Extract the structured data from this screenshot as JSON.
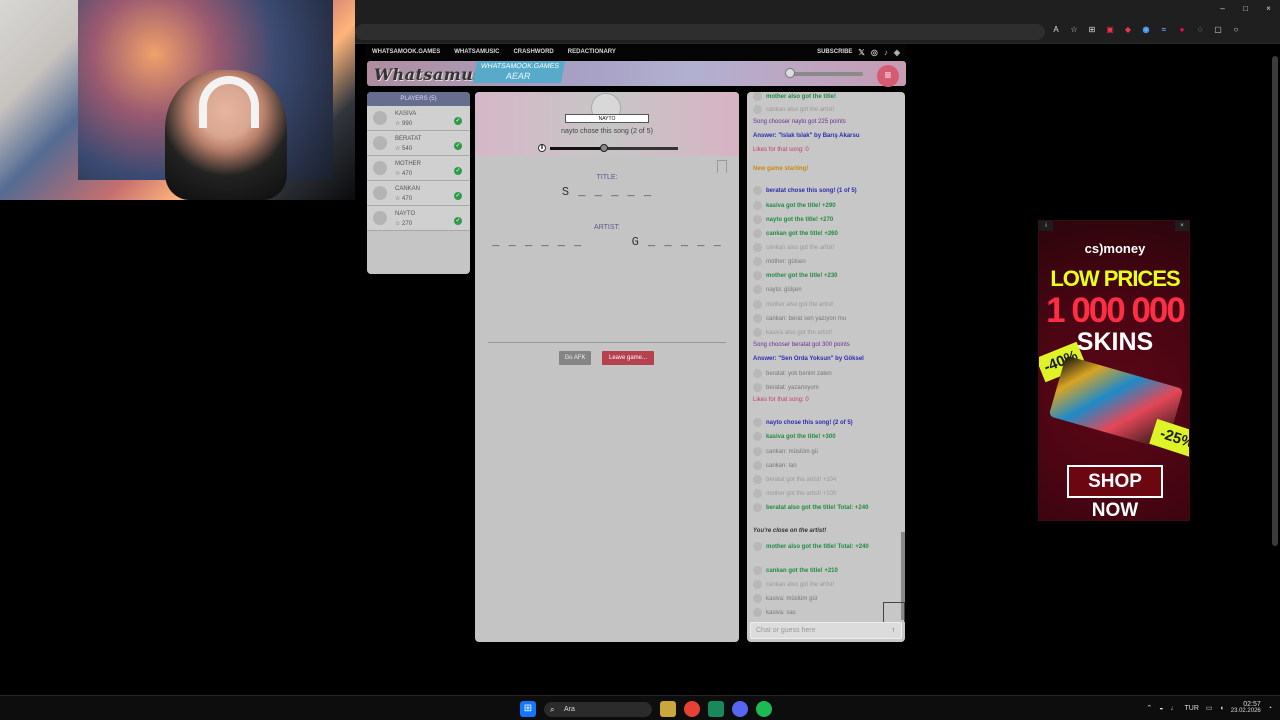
{
  "window": {
    "minimize": "–",
    "maximize": "□",
    "close": "×"
  },
  "toolbar": {
    "translate_icon": "A",
    "star_icon": "☆",
    "extensions": [
      "⊞",
      "▣",
      "◆",
      "◉",
      "≈",
      "●",
      "◌",
      "▢",
      "○"
    ]
  },
  "site": {
    "nav": {
      "items": [
        "WHATSAMOOK.GAMES",
        "WHATSAMUSIC",
        "CRASHWORD",
        "REDACTIONARY"
      ],
      "subscribe": "SUBSCRIBE",
      "social_icons": [
        "twitter",
        "instagram",
        "tiktok",
        "discord"
      ]
    },
    "logo": "Whatsamusic",
    "banner": {
      "line1": "WHATSAMOOK.GAMES",
      "line2": "AEAR"
    },
    "menu_icon": "≡"
  },
  "players": {
    "title": "PLAYERS (5)",
    "items": [
      {
        "name": "KASIVA",
        "score": "☆ 990"
      },
      {
        "name": "BERATAT",
        "score": "☆ 540"
      },
      {
        "name": "MOTHER",
        "score": "☆ 470"
      },
      {
        "name": "CANKAN",
        "score": "☆ 470"
      },
      {
        "name": "NAYTO",
        "score": "☆ 270"
      }
    ]
  },
  "game": {
    "chooser_name": "NAYTO",
    "chooser_text": "nayto chose this song (2 of 5)",
    "progress": 0.42,
    "title_label": "TITLE:",
    "title_value": "S _ _ _ _ _",
    "artist_label": "ARTIST:",
    "artist_value": "_ _ _ _ _ _      G _ _ _ _ _",
    "afk_button": "Go AFK",
    "leave_button": "Leave game..."
  },
  "chat": {
    "messages": [
      {
        "text": "mother also got the title!",
        "cls": "green",
        "dot": true
      },
      {
        "text": "cankan also got the artist!",
        "cls": "faint",
        "dot": true
      },
      {
        "text": "Song chooser nayto got 225 points",
        "cls": "purple",
        "dot": false
      },
      {
        "text": "Answer: \"Islak Islak\" by Barış Akarsu",
        "cls": "blue",
        "dot": false
      },
      {
        "text": "Likes for that song: 0",
        "cls": "pink",
        "dot": false
      },
      {
        "text": "New game starting!",
        "cls": "orange",
        "dot": false
      },
      {
        "text": "beratat chose this song! (1 of 5)",
        "cls": "blue",
        "dot": true
      },
      {
        "text": "kasiva got the title! +290",
        "cls": "green",
        "dot": true
      },
      {
        "text": "nayto got the title! +270",
        "cls": "green",
        "dot": true
      },
      {
        "text": "cankan got the title! +260",
        "cls": "green",
        "dot": true
      },
      {
        "text": "cankan also got the artist!",
        "cls": "faint",
        "dot": true
      },
      {
        "text": "mother: gülsen",
        "cls": "gray",
        "dot": true
      },
      {
        "text": "mother got the title! +230",
        "cls": "green",
        "dot": true
      },
      {
        "text": "nayto: gülşen",
        "cls": "gray",
        "dot": true
      },
      {
        "text": "mother also got the artist!",
        "cls": "faint",
        "dot": true
      },
      {
        "text": "cankan: berat sen yazıyon mu",
        "cls": "gray",
        "dot": true
      },
      {
        "text": "kasiva also got the artist!",
        "cls": "faint",
        "dot": true
      },
      {
        "text": "Song chooser beratat got 300 points",
        "cls": "purple",
        "dot": false
      },
      {
        "text": "Answer: \"Sen Orda Yoksun\" by Göksel",
        "cls": "blue",
        "dot": false
      },
      {
        "text": "beratat: yok benim zaten",
        "cls": "gray",
        "dot": true
      },
      {
        "text": "beratat: yazamıyom",
        "cls": "gray",
        "dot": true
      },
      {
        "text": "Likes for that song: 0",
        "cls": "pink",
        "dot": false
      },
      {
        "text": "nayto chose this song! (2 of 5)",
        "cls": "blue",
        "dot": true
      },
      {
        "text": "kasiva got the title! +300",
        "cls": "green",
        "dot": true
      },
      {
        "text": "cankan: müslüm gü",
        "cls": "gray",
        "dot": true
      },
      {
        "text": "cankan: lan",
        "cls": "gray",
        "dot": true
      },
      {
        "text": "beratat got the artist! +104",
        "cls": "faint",
        "dot": true
      },
      {
        "text": "mother got the artist! +100",
        "cls": "faint",
        "dot": true
      },
      {
        "text": "beratat also got the title! Total: +240",
        "cls": "green",
        "dot": true
      },
      {
        "text": "You're close on the artist!",
        "cls": "darkbold",
        "dot": false
      },
      {
        "text": "mother also got the title! Total: +240",
        "cls": "green",
        "dot": true
      },
      {
        "text": "cankan got the title! +210",
        "cls": "green",
        "dot": true
      },
      {
        "text": "cankan also got the artist!",
        "cls": "faint",
        "dot": true
      },
      {
        "text": "kasiva: müslüm gür",
        "cls": "gray",
        "dot": true
      },
      {
        "text": "kasiva: sas",
        "cls": "gray",
        "dot": true
      }
    ],
    "input_placeholder": "Chat or guess here",
    "send_icon": "↑"
  },
  "ad": {
    "info": "i",
    "close": "×",
    "brand": "cs)money",
    "headline": "LOW PRICES",
    "amount": "1 000 000",
    "product": "SKINS",
    "discount_left": "-40%",
    "discount_right": "-25%",
    "button": "SHOP NOW"
  },
  "taskbar": {
    "start_icon": "⊞",
    "search_placeholder": "Ara",
    "search_icon": "⌕",
    "apps": [
      "folder",
      "chrome",
      "store",
      "discord",
      "spotify"
    ],
    "tray_lang": "TUR",
    "time": "02:57",
    "date": "23.02.2026"
  },
  "colors": {
    "accent": "#6c7096",
    "leave": "#b6414f",
    "green": "#218b40",
    "blue": "#2b2bb0"
  }
}
